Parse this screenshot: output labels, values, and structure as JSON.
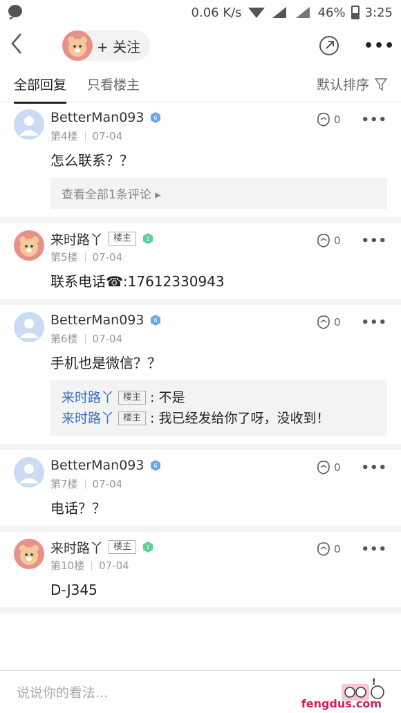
{
  "status": {
    "network": "0.06 K/s",
    "battery": "46%",
    "time": "3:25"
  },
  "header": {
    "follow_label": "+ 关注"
  },
  "tabs": {
    "all": "全部回复",
    "op_only": "只看楼主",
    "sort": "默认排序"
  },
  "comments": [
    {
      "user": "BetterMan093",
      "level": "6",
      "floor": "第4楼",
      "date": "07-04",
      "text": "怎么联系？？",
      "likes": "0",
      "more_link": "查看全部1条评论"
    },
    {
      "user": "来时路丫",
      "tag": "楼主",
      "level": "1",
      "floor": "第5楼",
      "date": "07-04",
      "text": "联系电话☎:17612330943",
      "likes": "0"
    },
    {
      "user": "BetterMan093",
      "level": "6",
      "floor": "第6楼",
      "date": "07-04",
      "text": "手机也是微信？？",
      "likes": "0",
      "replies": [
        {
          "user": "来时路丫",
          "tag": "楼主",
          "text": "不是"
        },
        {
          "user": "来时路丫",
          "tag": "楼主",
          "text": "我已经发给你了呀，没收到！"
        }
      ]
    },
    {
      "user": "BetterMan093",
      "level": "6",
      "floor": "第7楼",
      "date": "07-04",
      "text": "电话？？",
      "likes": "0"
    },
    {
      "user": "来时路丫",
      "tag": "楼主",
      "level": "1",
      "floor": "第10楼",
      "date": "07-04",
      "text": "D-J345",
      "likes": "0"
    }
  ],
  "footer": {
    "placeholder": "说说你的看法...",
    "watermark": "fengdus.com"
  }
}
